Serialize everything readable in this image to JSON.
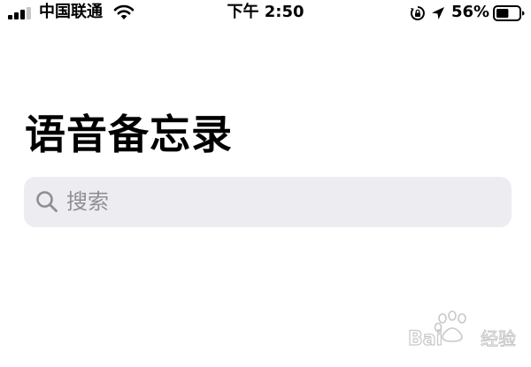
{
  "status_bar": {
    "carrier": "中国联通",
    "time": "下午 2:50",
    "battery_percent": "56%",
    "battery_level": 0.56,
    "signal_strength": "3 of 4 bars",
    "icons": [
      "signal-icon",
      "wifi-icon",
      "lock-rotation-icon",
      "location-icon",
      "battery-icon"
    ]
  },
  "page": {
    "title": "语音备忘录"
  },
  "search": {
    "placeholder": "搜索",
    "value": "",
    "icon": "search-icon"
  },
  "watermark": {
    "text": "Bai 经验",
    "icon": "baidu-paw-icon"
  },
  "colors": {
    "background": "#ffffff",
    "search_bg": "#ededf1",
    "placeholder": "#8e8e93",
    "text": "#000000"
  }
}
